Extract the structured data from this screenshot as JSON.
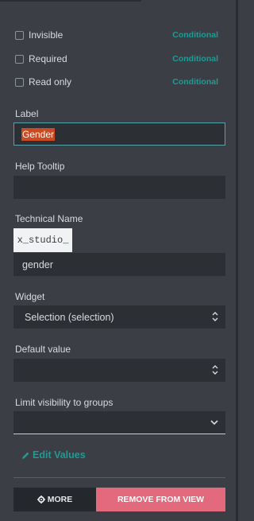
{
  "flags": [
    {
      "label": "Invisible",
      "action": "Conditional"
    },
    {
      "label": "Required",
      "action": "Conditional"
    },
    {
      "label": "Read only",
      "action": "Conditional"
    }
  ],
  "label_field": {
    "label": "Label",
    "value": "Gender"
  },
  "help_tooltip": {
    "label": "Help Tooltip",
    "value": ""
  },
  "technical_name": {
    "label": "Technical Name",
    "prefix": "x_studio_",
    "value": "gender"
  },
  "widget": {
    "label": "Widget",
    "value": "Selection (selection)"
  },
  "default_value": {
    "label": "Default value",
    "value": ""
  },
  "groups": {
    "label": "Limit visibility to groups",
    "value": ""
  },
  "edit_values": {
    "label": "Edit Values"
  },
  "footer": {
    "more_label": "MORE",
    "remove_label": "REMOVE FROM VIEW"
  },
  "colors": {
    "accent": "#1f9a95",
    "danger": "#e26a7c",
    "selection": "#c94b23"
  }
}
